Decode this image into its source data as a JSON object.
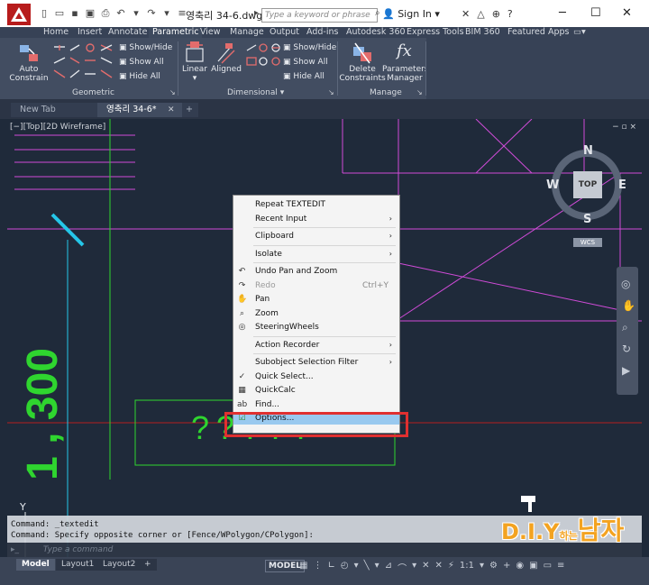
{
  "title_bar": {
    "doc_title": "영축리 34-6.dwg",
    "search_placeholder": "Type a keyword or phrase",
    "signin": "Sign In",
    "minimize": "─",
    "maximize": "☐",
    "close": "✕"
  },
  "ribbon_tabs": [
    "Home",
    "Insert",
    "Annotate",
    "Parametric",
    "View",
    "Manage",
    "Output",
    "Add-ins",
    "Autodesk 360",
    "Express Tools",
    "BIM 360",
    "Featured Apps"
  ],
  "active_ribbon_tab": "Parametric",
  "ribbon": {
    "auto_constrain": "Auto\nConstrain",
    "geometric_show_hide": "Show/Hide",
    "geometric_show_all": "Show All",
    "geometric_hide_all": "Hide All",
    "geometric_title": "Geometric",
    "linear": "Linear",
    "aligned": "Aligned",
    "dimensional_show_hide": "Show/Hide",
    "dimensional_show_all": "Show All",
    "dimensional_hide_all": "Hide All",
    "dimensional_title": "Dimensional",
    "delete_constraints": "Delete\nConstraints",
    "parameters_manager": "Parameters\nManager",
    "manage_title": "Manage",
    "fx": "fx"
  },
  "file_tabs": [
    "New Tab",
    "영축리 34-6*"
  ],
  "active_file_tab": "영축리 34-6*",
  "viewport": {
    "label": "[−][Top][2D Wireframe]",
    "controls": "− ▫ ×"
  },
  "viewcube": {
    "north": "N",
    "south": "S",
    "east": "E",
    "west": "W",
    "top": "TOP",
    "wcs": "WCS"
  },
  "drawing_text": {
    "dimension": "1 , 300",
    "question_marks": "?????",
    "y_axis": "Y"
  },
  "context_menu": [
    {
      "label": "Repeat TEXTEDIT",
      "submenu": false,
      "icon": ""
    },
    {
      "label": "Recent Input",
      "submenu": true,
      "icon": ""
    },
    {
      "sep": true
    },
    {
      "label": "Clipboard",
      "submenu": true,
      "icon": ""
    },
    {
      "sep": true
    },
    {
      "label": "Isolate",
      "submenu": true,
      "icon": ""
    },
    {
      "sep": true
    },
    {
      "label": "Undo Pan and Zoom",
      "submenu": false,
      "icon": "undo-icon"
    },
    {
      "label": "Redo",
      "submenu": false,
      "shortcut": "Ctrl+Y",
      "disabled": true,
      "icon": "redo-icon"
    },
    {
      "label": "Pan",
      "submenu": false,
      "icon": "pan-icon"
    },
    {
      "label": "Zoom",
      "submenu": false,
      "icon": "zoom-icon"
    },
    {
      "label": "SteeringWheels",
      "submenu": false,
      "icon": "steeringwheels-icon"
    },
    {
      "sep": true
    },
    {
      "label": "Action Recorder",
      "submenu": true,
      "icon": ""
    },
    {
      "sep": true
    },
    {
      "label": "Subobject Selection Filter",
      "submenu": true,
      "icon": ""
    },
    {
      "label": "Quick Select...",
      "submenu": false,
      "icon": "quick-select-icon"
    },
    {
      "label": "QuickCalc",
      "submenu": false,
      "icon": "quickcalc-icon"
    },
    {
      "label": "Find...",
      "submenu": false,
      "icon": "find-icon"
    },
    {
      "label": "Options...",
      "submenu": false,
      "icon": "options-icon",
      "highlight": true
    }
  ],
  "command_line": {
    "line1": "Command: _textedit",
    "line2": "Command: Specify opposite corner or [Fence/WPolygon/CPolygon]:",
    "prompt_placeholder": "Type a command"
  },
  "layout_tabs": [
    "Model",
    "Layout1",
    "Layout2"
  ],
  "active_layout_tab": "Model",
  "status_bar": {
    "model": "MODEL",
    "scale": "1:1"
  },
  "watermark": {
    "text": "D.I.Y",
    "small": "하는",
    "kor": "남자"
  },
  "colors": {
    "canvas_bg": "#1f2a3a",
    "magenta": "#d04bd8",
    "green": "#2fd52f",
    "cyan": "#25c6e8",
    "red_axis": "#b61e1e",
    "highlight": "#99c9ef",
    "highlight_border": "#e03030",
    "autocad_red": "#b71c1c"
  }
}
